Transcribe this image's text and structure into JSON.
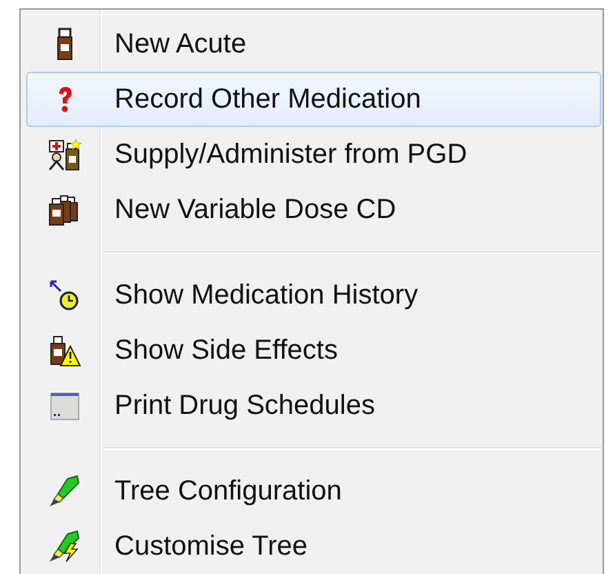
{
  "menu": {
    "items": [
      {
        "kind": "item",
        "label": "New Acute",
        "selected": false
      },
      {
        "kind": "item",
        "label": "Record Other Medication",
        "selected": true
      },
      {
        "kind": "item",
        "label": "Supply/Administer from PGD",
        "selected": false
      },
      {
        "kind": "item",
        "label": "New Variable Dose CD",
        "selected": false
      },
      {
        "kind": "separator"
      },
      {
        "kind": "item",
        "label": "Show Medication History",
        "selected": false
      },
      {
        "kind": "item",
        "label": "Show Side Effects",
        "selected": false
      },
      {
        "kind": "item",
        "label": "Print Drug Schedules",
        "selected": false
      },
      {
        "kind": "separator"
      },
      {
        "kind": "item",
        "label": "Tree Configuration",
        "selected": false
      },
      {
        "kind": "item",
        "label": "Customise Tree",
        "selected": false
      }
    ]
  }
}
